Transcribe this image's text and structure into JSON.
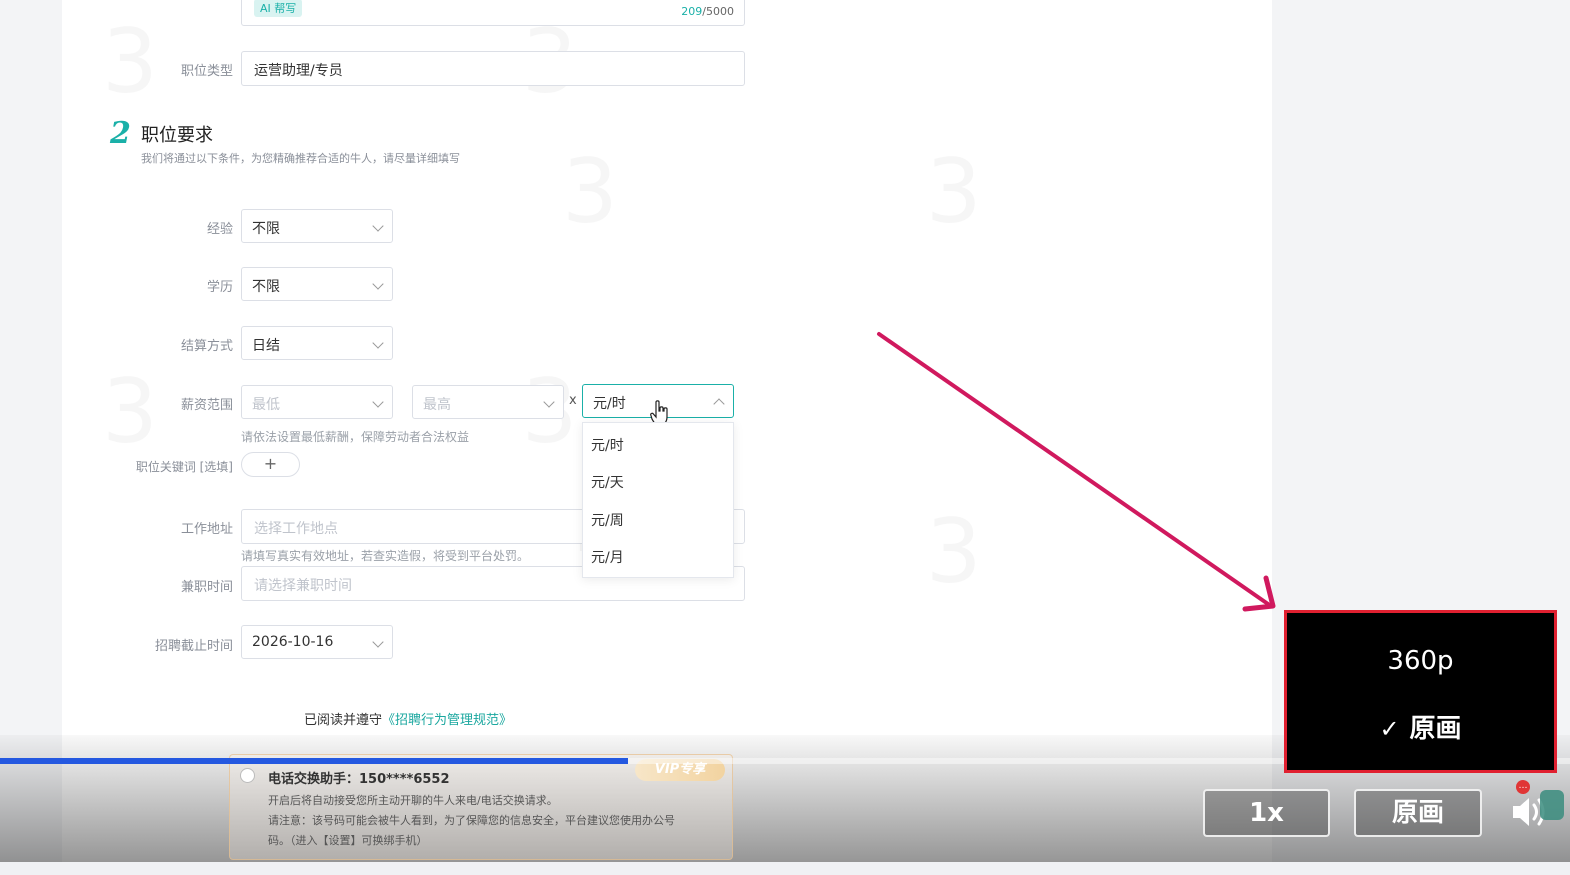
{
  "description_field": {
    "ai_badge": "AI 帮写",
    "count_current": "209",
    "count_max": "/5000"
  },
  "job_type": {
    "label": "职位类型",
    "value": "运营助理/专员"
  },
  "section2": {
    "number": "2",
    "title": "职位要求",
    "subtitle": "我们将通过以下条件，为您精确推荐合适的牛人，请尽量详细填写"
  },
  "experience": {
    "label": "经验",
    "value": "不限"
  },
  "education": {
    "label": "学历",
    "value": "不限"
  },
  "settlement": {
    "label": "结算方式",
    "value": "日结"
  },
  "salary": {
    "label": "薪资范围",
    "min_placeholder": "最低",
    "max_placeholder": "最高",
    "times": "x",
    "unit_value": "元/时",
    "hint": "请依法设置最低薪酬，保障劳动者合法权益",
    "unit_options": [
      "元/时",
      "元/天",
      "元/周",
      "元/月"
    ]
  },
  "keywords": {
    "label": "职位关键词 [选填]",
    "add": "+"
  },
  "address": {
    "label": "工作地址",
    "placeholder": "选择工作地点",
    "hint": "请填写真实有效地址，若查实造假，将受到平台处罚。"
  },
  "parttime": {
    "label": "兼职时间",
    "placeholder": "请选择兼职时间"
  },
  "deadline": {
    "label": "招聘截止时间",
    "value": "2026-10-16"
  },
  "agreement": {
    "prefix": "已阅读并遵守",
    "link": "《招聘行为管理规范》"
  },
  "phone_helper": {
    "title": "电话交换助手：150****6552",
    "line1": "开启后将自动接受您所主动开聊的牛人来电/电话交换请求。",
    "line2": "请注意：该号码可能会被牛人看到，为了保障您的信息安全，平台建议您使用办公号",
    "line3": "码。（进入【设置】可换绑手机）",
    "vip": "VIP专享"
  },
  "player": {
    "progress": 0.4,
    "speed_label": "1x",
    "quality_label": "原画",
    "quality_menu": [
      "360p",
      "原画"
    ],
    "quality_selected": "原画"
  },
  "colors": {
    "accent_teal": "#1ab0a8",
    "link": "#1aa79f",
    "progress": "#2458e0",
    "annotation": "#d0195e",
    "highlight_border": "#e02030"
  }
}
